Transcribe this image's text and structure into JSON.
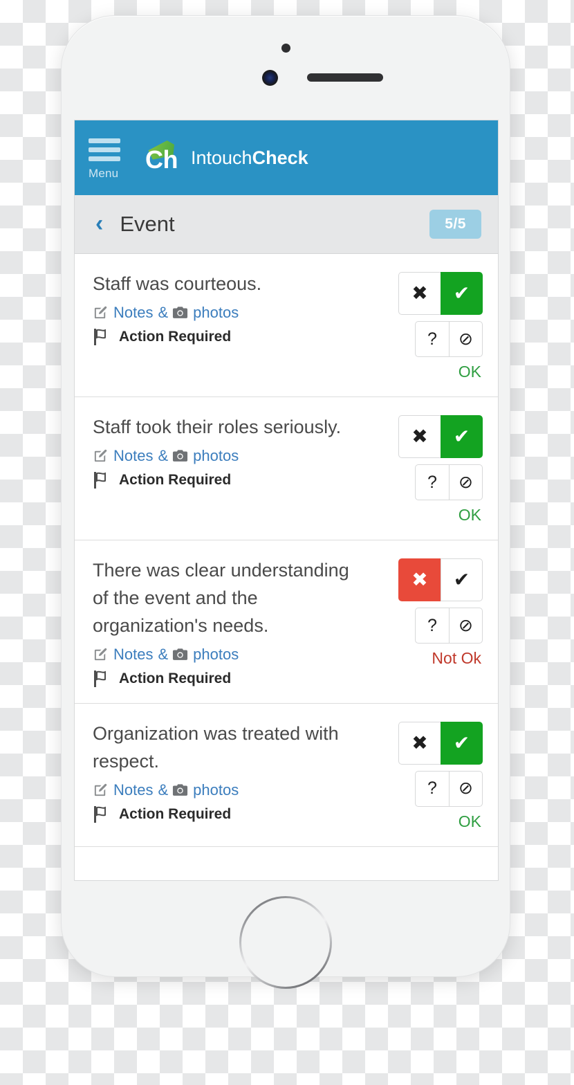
{
  "app": {
    "header": {
      "menu_label": "Menu",
      "menu_icon": "hamburger-icon",
      "logo_mark_text": "Ch",
      "brand_name_light": "Intouch",
      "brand_name_bold": "Check",
      "background_color": "#2a92c4"
    },
    "subheader": {
      "back_icon": "chevron-left-icon",
      "title": "Event",
      "progress_badge": "5/5",
      "badge_color": "#9ccfe4",
      "background_color": "#e6e7e8"
    }
  },
  "colors": {
    "ok_green": "#13a321",
    "notok_red": "#e84a3a",
    "link_blue": "#3b7dbd",
    "status_ok": "#2f9e41",
    "status_notok": "#c0392b"
  },
  "labels": {
    "notes": "Notes",
    "amp": "&",
    "photos": "photos",
    "action_required": "Action Required",
    "btn_no": "✖",
    "btn_yes": "✔",
    "btn_question": "?",
    "btn_na": "⊘"
  },
  "questions": [
    {
      "text": "Staff was courteous.",
      "answer": "ok",
      "status_label": "OK"
    },
    {
      "text": "Staff took their roles seriously.",
      "answer": "ok",
      "status_label": "OK"
    },
    {
      "text": "There was clear understanding of the event and the organization's needs.",
      "answer": "notok",
      "status_label": "Not Ok"
    },
    {
      "text": "Organization was treated with respect.",
      "answer": "ok",
      "status_label": "OK"
    }
  ]
}
